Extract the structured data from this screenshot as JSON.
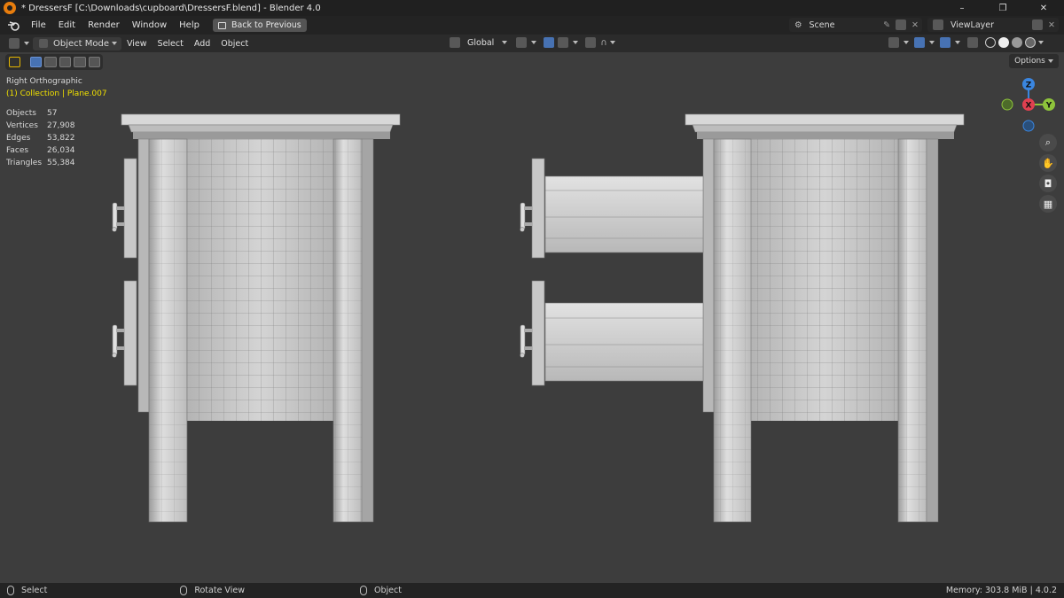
{
  "window": {
    "title": "* DressersF [C:\\Downloads\\cupboard\\DressersF.blend] - Blender 4.0",
    "controls": [
      "–",
      "❐",
      "✕"
    ]
  },
  "menu": {
    "items": [
      "File",
      "Edit",
      "Render",
      "Window",
      "Help"
    ],
    "back_button": "Back to Previous",
    "scene_label": "Scene",
    "viewlayer_label": "ViewLayer"
  },
  "header": {
    "mode": "Object Mode",
    "items": [
      "View",
      "Select",
      "Add",
      "Object"
    ],
    "orientation": "Global"
  },
  "viewport": {
    "view_name": "Right Orthographic",
    "collection": "(1) Collection | Plane.007",
    "options_label": "Options",
    "stats": [
      {
        "label": "Objects",
        "value": "57"
      },
      {
        "label": "Vertices",
        "value": "27,908"
      },
      {
        "label": "Edges",
        "value": "53,822"
      },
      {
        "label": "Faces",
        "value": "26,034"
      },
      {
        "label": "Triangles",
        "value": "55,384"
      }
    ],
    "gizmo": {
      "x_label": "X",
      "y_label": "Y",
      "z_label": "Z",
      "x_color": "#e04050",
      "y_color": "#8ec43b",
      "z_color": "#3a86e0"
    }
  },
  "status": {
    "select": "Select",
    "rotate": "Rotate View",
    "object": "Object",
    "memory": "Memory: 303.8 MiB | 4.0.2"
  }
}
